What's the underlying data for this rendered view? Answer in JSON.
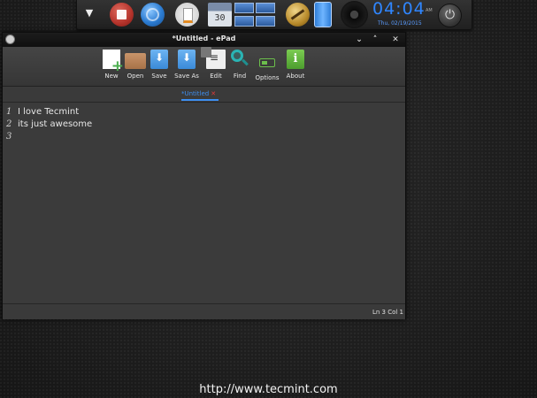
{
  "dock": {
    "calendar_day": "30",
    "clock": {
      "time": "04:04",
      "ampm": "AM",
      "date": "Thu, 02/19/2015"
    }
  },
  "window": {
    "title": "*Untitled - ePad",
    "controls": {
      "minimize": "⌄",
      "maximize": "˄",
      "close": "✕"
    }
  },
  "toolbar": {
    "new_label": "New",
    "open_label": "Open",
    "save_label": "Save",
    "saveas_label": "Save As",
    "edit_label": "Edit",
    "find_label": "Find",
    "options_label": "Options",
    "about_label": "About"
  },
  "tabs": [
    {
      "label": "*Untitled",
      "close": "✕"
    }
  ],
  "editor": {
    "lines": [
      {
        "num": "1",
        "text": "I love Tecmint"
      },
      {
        "num": "2",
        "text": "its just awesome"
      },
      {
        "num": "3",
        "text": ""
      }
    ]
  },
  "status": {
    "position": "Ln 3 Col 1"
  },
  "watermark": "http://www.tecmint.com",
  "colors": {
    "accent": "#2f86ff",
    "tab": "#3d8ef0",
    "tab_close": "#e03a3a"
  }
}
